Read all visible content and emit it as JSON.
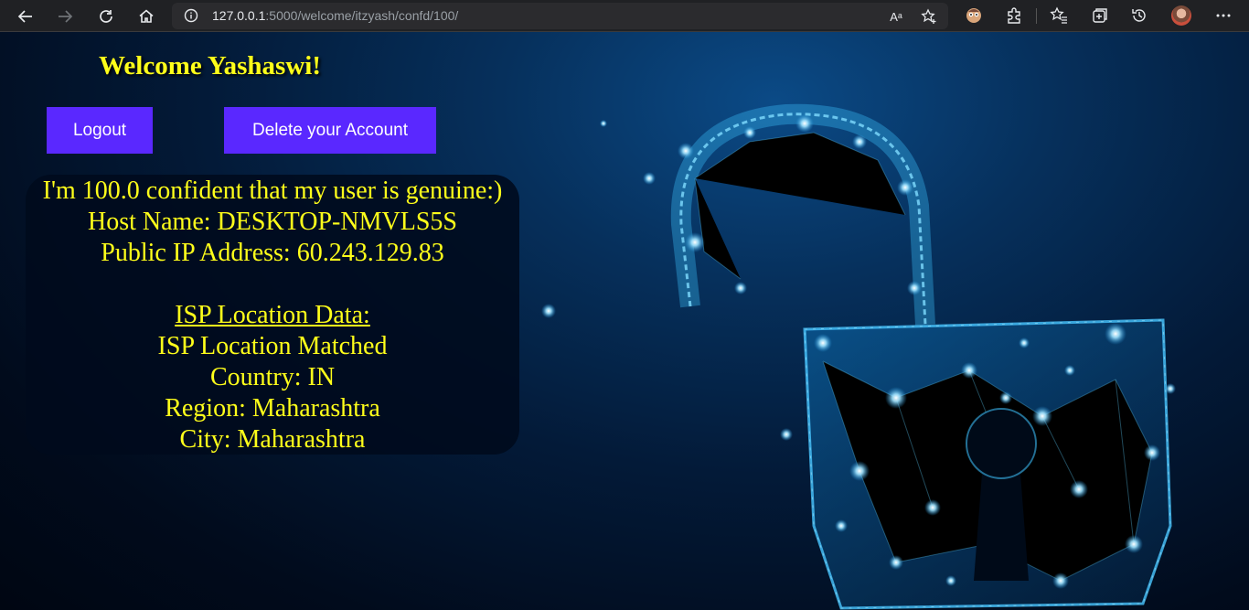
{
  "browser": {
    "url_host": "127.0.0.1",
    "url_path": ":5000/welcome/itzyash/confd/100/",
    "reader_label": "Aᵃ"
  },
  "welcome": {
    "title": "Welcome Yashaswi!"
  },
  "buttons": {
    "logout": "Logout",
    "delete": "Delete your Account"
  },
  "info": {
    "confidence": "I'm 100.0 confident that my user is genuine:)",
    "host_name": "Host Name: DESKTOP-NMVLS5S",
    "public_ip": "Public IP Address: 60.243.129.83",
    "isp_heading": "ISP Location Data:",
    "isp_status": "ISP Location Matched",
    "country": "Country: IN",
    "region": "Region: Maharashtra",
    "city": "City: Maharashtra"
  },
  "colors": {
    "text_accent": "#ffff1a",
    "button_bg": "#5a28ff",
    "chrome_bg": "#202124"
  }
}
